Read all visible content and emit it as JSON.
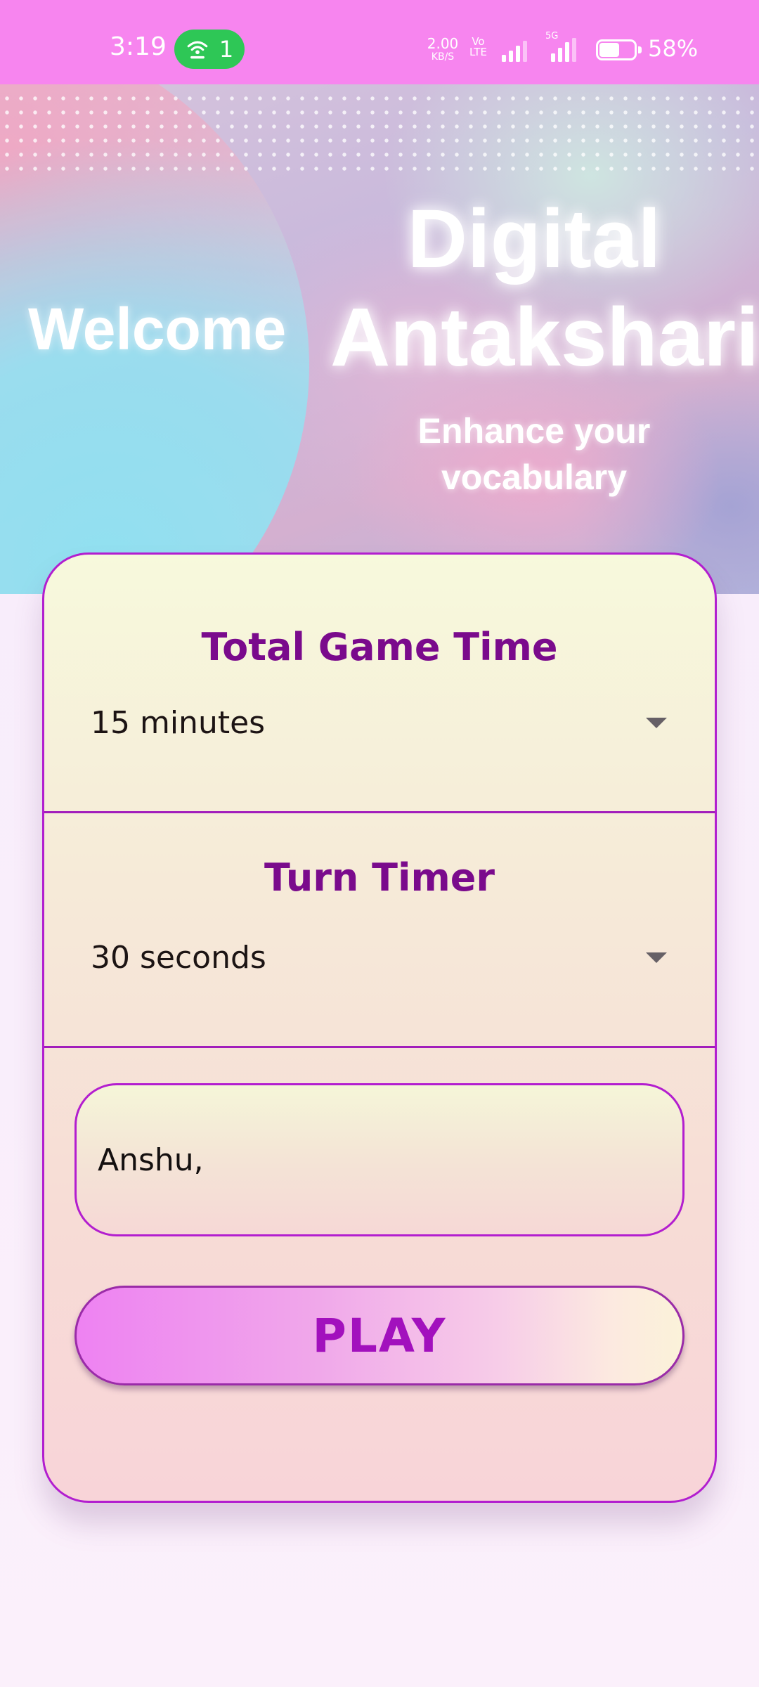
{
  "status_bar": {
    "time": "3:19",
    "hotspot_count": "1",
    "net_speed_value": "2.00",
    "net_speed_unit": "KB/S",
    "volte_top": "Vo",
    "volte_bottom": "LTE",
    "network_type": "5G",
    "battery_percent": "58%",
    "battery_level": 0.58,
    "colors": {
      "bar_background": "#f785ef",
      "hotspot_pill": "#2ec756"
    }
  },
  "hero": {
    "welcome": "Welcome",
    "title_line1": "Digital",
    "title_line2": "Antakshari",
    "subtitle_line1": "Enhance your",
    "subtitle_line2": "vocabulary"
  },
  "settings": {
    "game_time": {
      "label": "Total Game Time",
      "selected": "15 minutes"
    },
    "turn_timer": {
      "label": "Turn Timer",
      "selected": "30 seconds"
    }
  },
  "player_input": {
    "value": "Anshu,"
  },
  "play_button": {
    "label": "PLAY"
  },
  "colors": {
    "accent_purple": "#7a0a8c",
    "border_purple": "#b21ecf",
    "play_text": "#a210bd"
  }
}
